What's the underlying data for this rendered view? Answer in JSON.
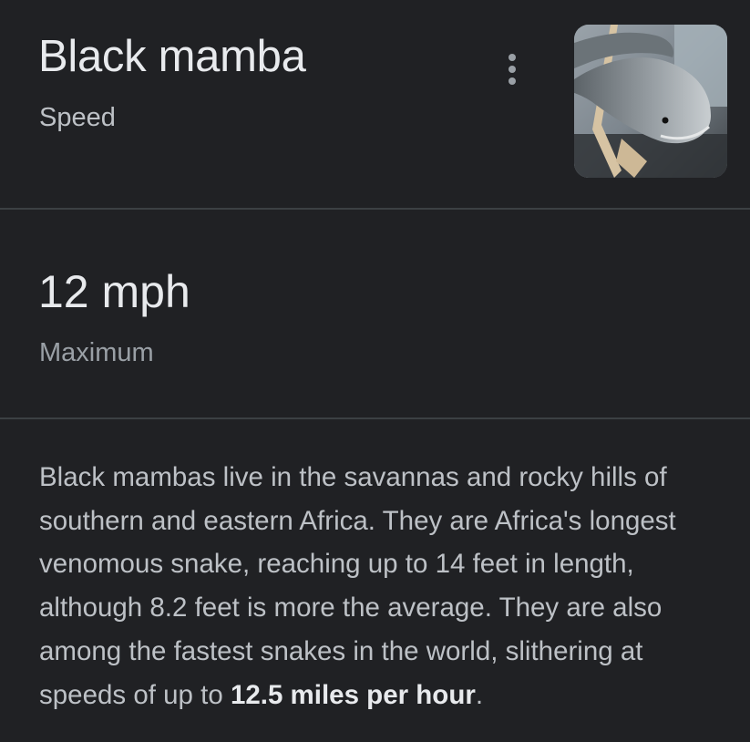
{
  "header": {
    "title": "Black mamba",
    "subtitle": "Speed",
    "more_icon": "more-vert-icon",
    "thumbnail_icon": "snake-photo"
  },
  "stat": {
    "value": "12 mph",
    "label": "Maximum"
  },
  "description": {
    "text": "Black mambas live in the savannas and rocky hills of southern and eastern Africa. They are Africa's longest venomous snake, reaching up to 14 feet in length, although 8.2 feet is more the average. They are also among the fastest snakes in the world, slithering at speeds of up to ",
    "highlight": "12.5 miles per hour",
    "suffix": "."
  },
  "colors": {
    "background": "#202124",
    "primary_text": "#e8eaed",
    "secondary_text": "#bdc1c6",
    "divider": "#3c4043"
  }
}
